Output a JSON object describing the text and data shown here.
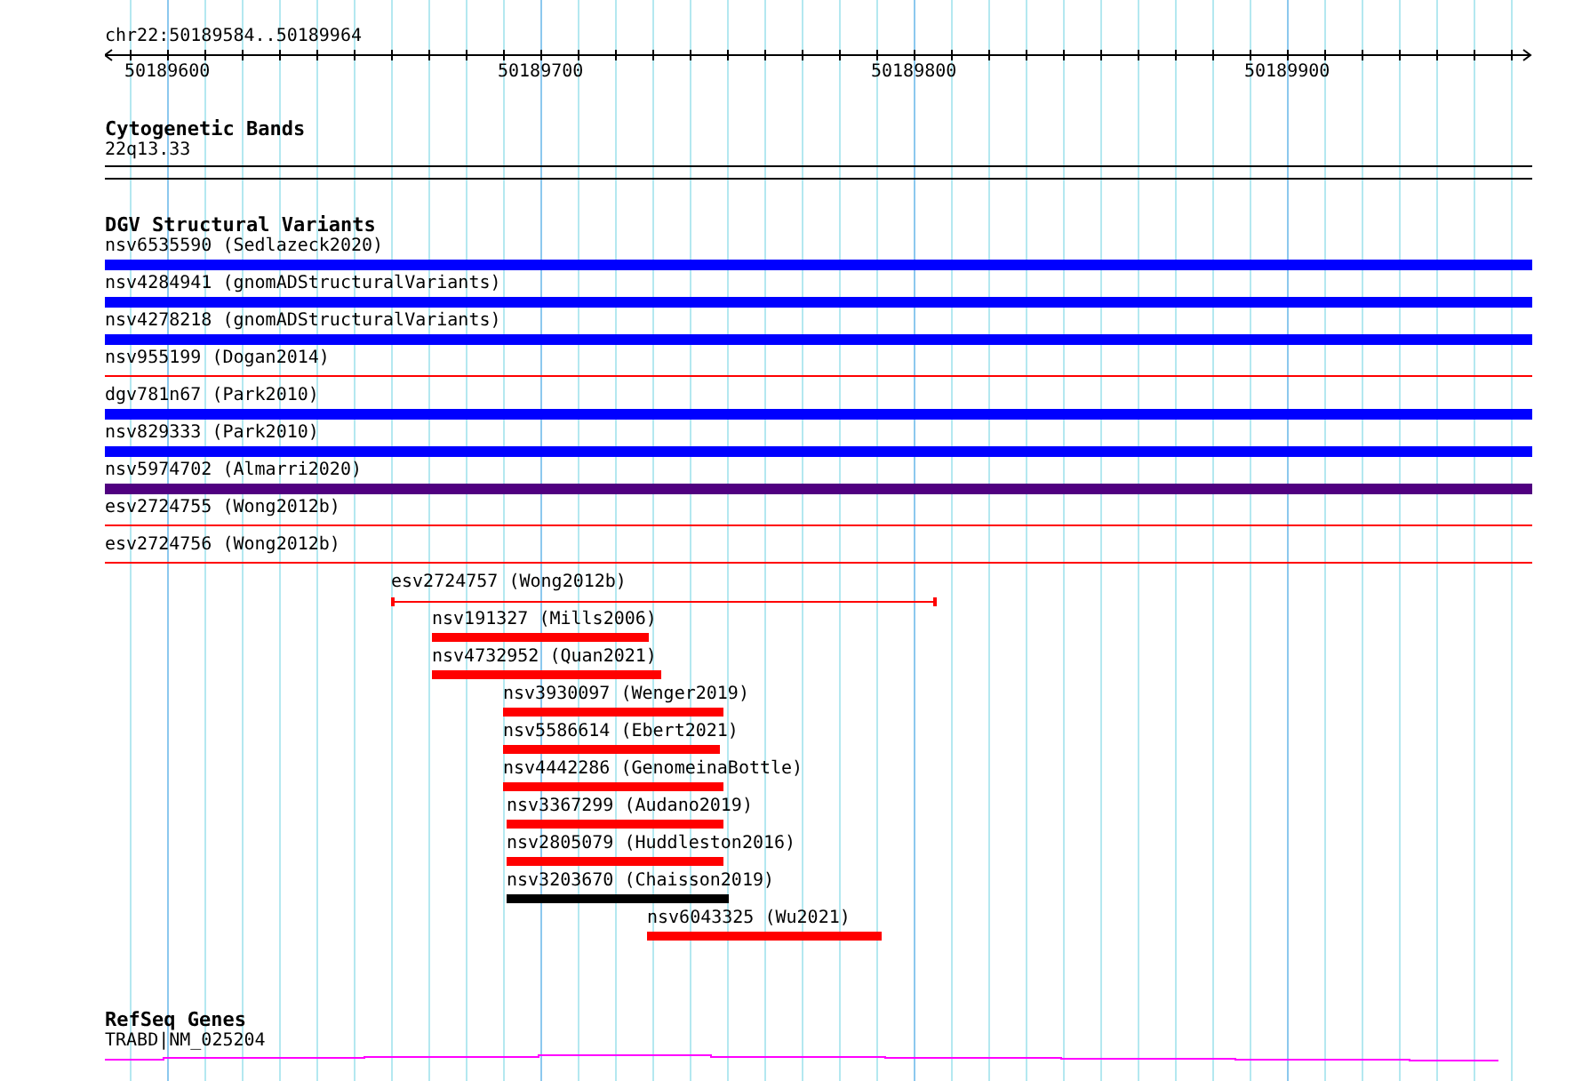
{
  "ruler": {
    "position": "chr22:50189584..50189964",
    "tick_labels": [
      "50189600",
      "50189700",
      "50189800",
      "50189900"
    ]
  },
  "tracks": [
    {
      "title": "Cytogenetic Bands",
      "features": [
        {
          "kind": "band",
          "label": "22q13.33"
        }
      ]
    },
    {
      "title": "DGV Structural Variants",
      "features": [
        {
          "kind": "thick",
          "label": "nsv6535590 (Sedlazeck2020)",
          "color": "#0000ff"
        },
        {
          "kind": "thick",
          "label": "nsv4284941 (gnomADStructuralVariants)",
          "color": "#0000ff"
        },
        {
          "kind": "thick",
          "label": "nsv4278218 (gnomADStructuralVariants)",
          "color": "#0000ff"
        },
        {
          "kind": "thin",
          "label": "nsv955199 (Dogan2014)",
          "color": "#ff0000"
        },
        {
          "kind": "thick",
          "label": "dgv781n67 (Park2010)",
          "color": "#0000ff"
        },
        {
          "kind": "thick",
          "label": "nsv829333 (Park2010)",
          "color": "#0000ff"
        },
        {
          "kind": "thick",
          "label": "nsv5974702 (Almarri2020)",
          "color": "#500080"
        },
        {
          "kind": "thin",
          "label": "esv2724755 (Wong2012b)",
          "color": "#ff0000"
        },
        {
          "kind": "thin",
          "label": "esv2724756 (Wong2012b)",
          "color": "#ff0000"
        },
        {
          "kind": "range",
          "label": "esv2724757 (Wong2012b)",
          "color": "#ff0000"
        },
        {
          "kind": "bar",
          "label": "nsv191327 (Mills2006)",
          "color": "#ff0000"
        },
        {
          "kind": "bar",
          "label": "nsv4732952 (Quan2021)",
          "color": "#ff0000"
        },
        {
          "kind": "bar",
          "label": "nsv3930097 (Wenger2019)",
          "color": "#ff0000"
        },
        {
          "kind": "bar",
          "label": "nsv5586614 (Ebert2021)",
          "color": "#ff0000"
        },
        {
          "kind": "bar",
          "label": "nsv4442286 (GenomeinaBottle)",
          "color": "#ff0000"
        },
        {
          "kind": "bar",
          "label": "nsv3367299 (Audano2019)",
          "color": "#ff0000"
        },
        {
          "kind": "bar",
          "label": "nsv2805079 (Huddleston2016)",
          "color": "#ff0000"
        },
        {
          "kind": "bar",
          "label": "nsv3203670 (Chaisson2019)",
          "color": "#000000"
        },
        {
          "kind": "bar",
          "label": "nsv6043325 (Wu2021)",
          "color": "#ff0000"
        }
      ]
    },
    {
      "title": "RefSeq Genes",
      "features": [
        {
          "kind": "gene",
          "label": "TRABD|NM_025204"
        }
      ]
    }
  ]
}
